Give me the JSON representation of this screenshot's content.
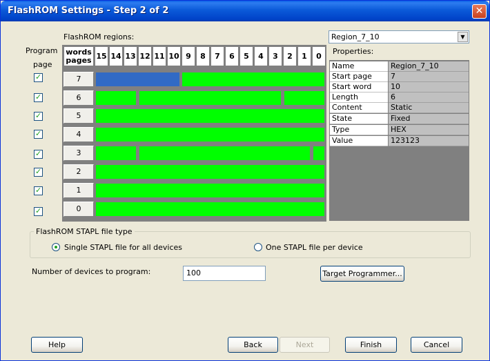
{
  "window": {
    "title": "FlashROM Settings - Step 2 of 2",
    "close_label": "✕"
  },
  "left": {
    "program_label": "Program",
    "page_label": "page"
  },
  "grid": {
    "regions_label": "FlashROM regions:",
    "corner_words": "words",
    "corner_pages": "pages",
    "word_headers": [
      "15",
      "14",
      "13",
      "12",
      "11",
      "10",
      "9",
      "8",
      "7",
      "6",
      "5",
      "4",
      "3",
      "2",
      "1",
      "0"
    ],
    "pages": [
      "7",
      "6",
      "5",
      "4",
      "3",
      "2",
      "1",
      "0"
    ]
  },
  "properties": {
    "region_selected": "Region_7_10",
    "label": "Properties:",
    "rows": [
      {
        "name": "Name",
        "value": "Region_7_10"
      },
      {
        "name": "Start page",
        "value": "7"
      },
      {
        "name": "Start word",
        "value": "10"
      },
      {
        "name": "Length",
        "value": "6"
      },
      {
        "name": "Content",
        "value": "Static"
      },
      {
        "name": "State",
        "value": "Fixed"
      },
      {
        "name": "Type",
        "value": "HEX"
      },
      {
        "name": "Value",
        "value": "123123"
      }
    ]
  },
  "stapl": {
    "group_label": "FlashROM STAPL file type",
    "option_single": "Single STAPL file for all devices",
    "option_per_device": "One STAPL file per device",
    "selected": "single"
  },
  "devices": {
    "label": "Number of devices to program:",
    "value": "100"
  },
  "buttons": {
    "target_programmer": "Target Programmer...",
    "help": "Help",
    "back": "Back",
    "next": "Next",
    "finish": "Finish",
    "cancel": "Cancel"
  },
  "colors": {
    "used": "#00ff00",
    "selected": "#316ac5"
  }
}
